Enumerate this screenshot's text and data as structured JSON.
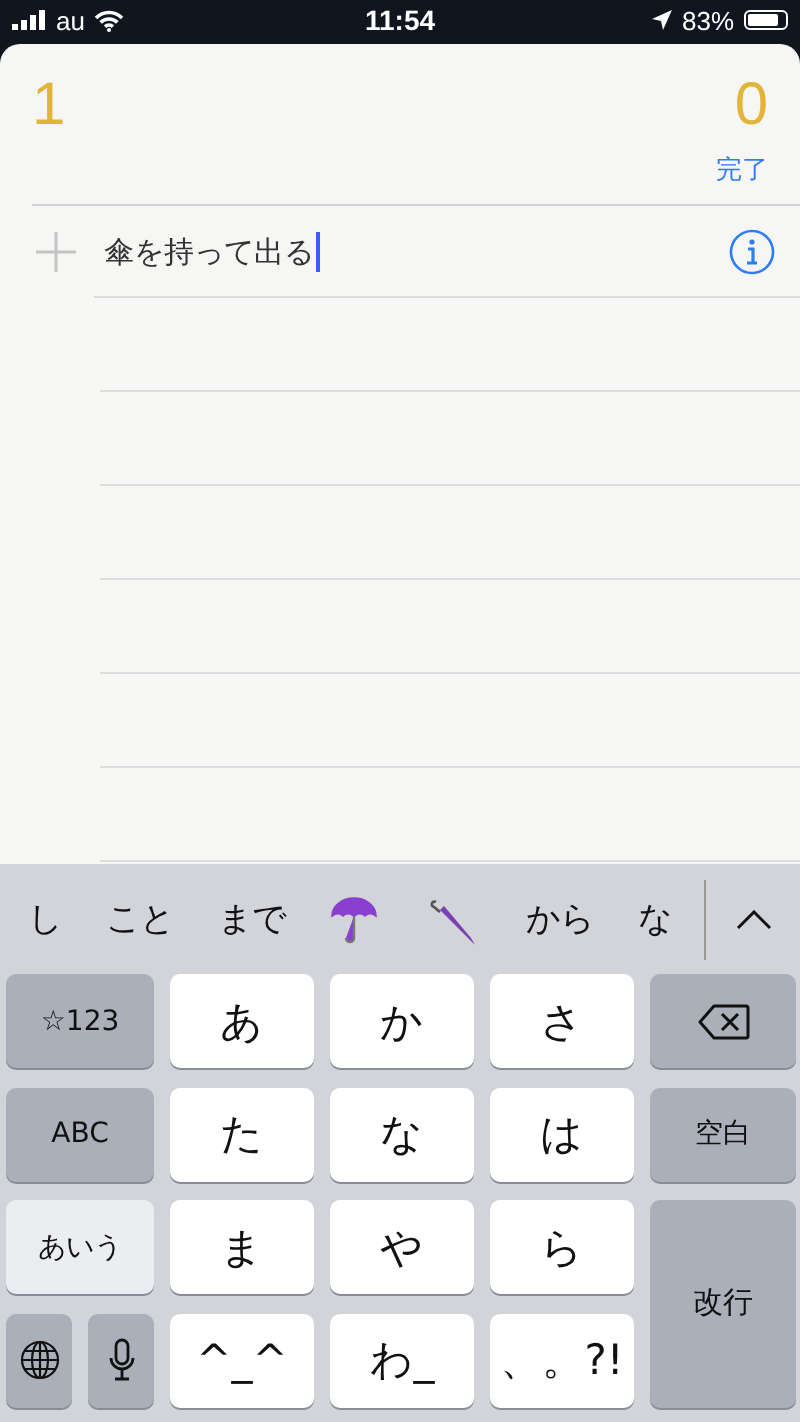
{
  "status_bar": {
    "carrier": "au",
    "time": "11:54",
    "battery": "83%"
  },
  "list": {
    "count": "1",
    "completed_count": "0",
    "completed_label": "完了"
  },
  "new_item": {
    "value": "傘を持って出る"
  },
  "candidates": [
    {
      "kind": "text",
      "text": "し"
    },
    {
      "kind": "text",
      "text": "こと"
    },
    {
      "kind": "text",
      "text": "まで"
    },
    {
      "kind": "umbrella"
    },
    {
      "kind": "closed_umbrella"
    },
    {
      "kind": "text",
      "text": "から"
    },
    {
      "kind": "text",
      "text": "な"
    }
  ],
  "keys": [
    {
      "kind": "func",
      "label": "☆123"
    },
    {
      "kind": "char",
      "label": "あ"
    },
    {
      "kind": "char",
      "label": "か"
    },
    {
      "kind": "char",
      "label": "さ"
    },
    {
      "kind": "backspace"
    },
    {
      "kind": "func",
      "label": "ABC"
    },
    {
      "kind": "char",
      "label": "た"
    },
    {
      "kind": "char",
      "label": "な"
    },
    {
      "kind": "char",
      "label": "は"
    },
    {
      "kind": "func",
      "label": "空白"
    },
    {
      "kind": "mode",
      "label": "あいう"
    },
    {
      "kind": "char",
      "label": "ま"
    },
    {
      "kind": "char",
      "label": "や"
    },
    {
      "kind": "char",
      "label": "ら"
    },
    {
      "kind": "return",
      "label": "改行"
    },
    {
      "kind": "globe"
    },
    {
      "kind": "mic"
    },
    {
      "kind": "char",
      "label": "^_^"
    },
    {
      "kind": "char",
      "label": "わ_"
    },
    {
      "kind": "char",
      "label": "、。?!"
    }
  ]
}
